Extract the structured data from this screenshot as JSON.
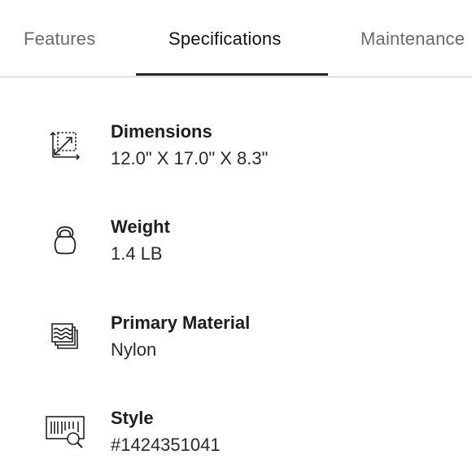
{
  "tabs": [
    {
      "label": "Features",
      "active": false
    },
    {
      "label": "Specifications",
      "active": true
    },
    {
      "label": "Maintenance",
      "active": false
    }
  ],
  "specs": [
    {
      "icon": "dimensions-icon",
      "label": "Dimensions",
      "value": "12.0\" X 17.0\" X 8.3\""
    },
    {
      "icon": "kettlebell-weight-icon",
      "label": "Weight",
      "value": "1.4 LB"
    },
    {
      "icon": "material-swatch-icon",
      "label": "Primary Material",
      "value": "Nylon"
    },
    {
      "icon": "barcode-search-icon",
      "label": "Style",
      "value": "#1424351041"
    }
  ],
  "colors": {
    "active_tab_text": "#111111",
    "inactive_tab_text": "#6b6b6b",
    "underline": "#222222",
    "divider": "#c8c8c8"
  }
}
